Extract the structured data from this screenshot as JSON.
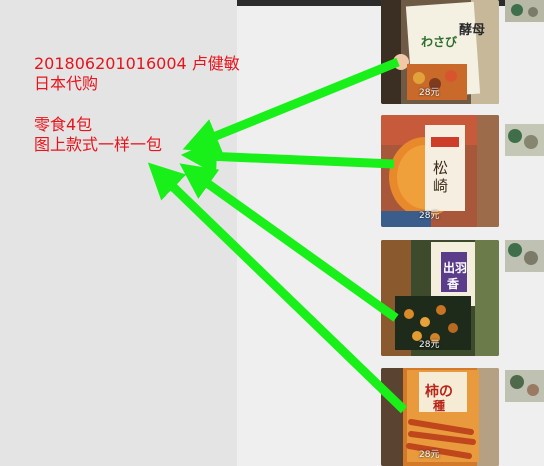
{
  "note": {
    "order_line": "201806201016004   卢健敏",
    "service_line": "日本代购",
    "item_line": "零食4包",
    "instruction_line": "图上款式一样一包"
  },
  "products": [
    {
      "package_text": "酵母 わさび野菜",
      "price": "28元"
    },
    {
      "package_text": "松崎煎",
      "price": "28元"
    },
    {
      "package_text": "出羽香",
      "price": "28元"
    },
    {
      "package_text": "柿の種",
      "price": "28元"
    }
  ],
  "colors": {
    "note_text": "#e8141c",
    "arrow": "#19f019",
    "left_panel": "#e4e4e4",
    "right_panel": "#efefef",
    "top_bar": "#2c2c2c"
  }
}
